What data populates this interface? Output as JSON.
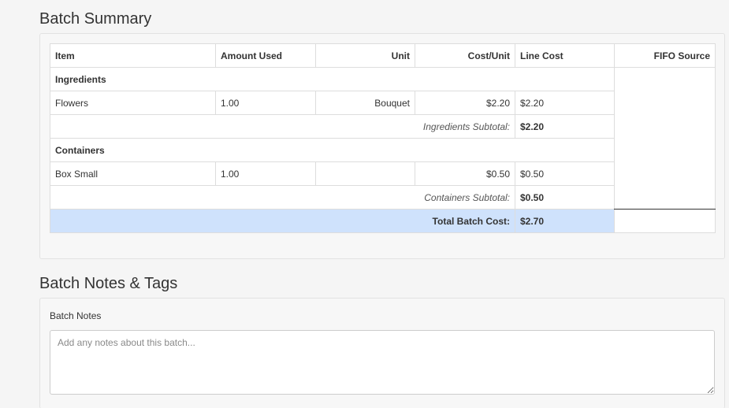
{
  "summary": {
    "title": "Batch Summary",
    "columns": {
      "item": "Item",
      "amount_used": "Amount Used",
      "unit": "Unit",
      "cost_unit": "Cost/Unit",
      "line_cost": "Line Cost",
      "fifo_source": "FIFO Source"
    },
    "ingredients": {
      "group_label": "Ingredients",
      "rows": [
        {
          "item": "Flowers",
          "amount": "1.00",
          "unit": "Bouquet",
          "cost_unit": "$2.20",
          "line_cost": "$2.20"
        }
      ],
      "subtotal_label": "Ingredients Subtotal:",
      "subtotal_value": "$2.20"
    },
    "containers": {
      "group_label": "Containers",
      "rows": [
        {
          "item": "Box Small",
          "amount": "1.00",
          "unit": "",
          "cost_unit": "$0.50",
          "line_cost": "$0.50"
        }
      ],
      "subtotal_label": "Containers Subtotal:",
      "subtotal_value": "$0.50"
    },
    "total_label": "Total Batch Cost:",
    "total_value": "$2.70"
  },
  "notes": {
    "title": "Batch Notes & Tags",
    "label": "Batch Notes",
    "value": "",
    "placeholder": "Add any notes about this batch..."
  },
  "colors": {
    "total_row": "#cfe2fc",
    "group_row": "#e4e4e4"
  }
}
